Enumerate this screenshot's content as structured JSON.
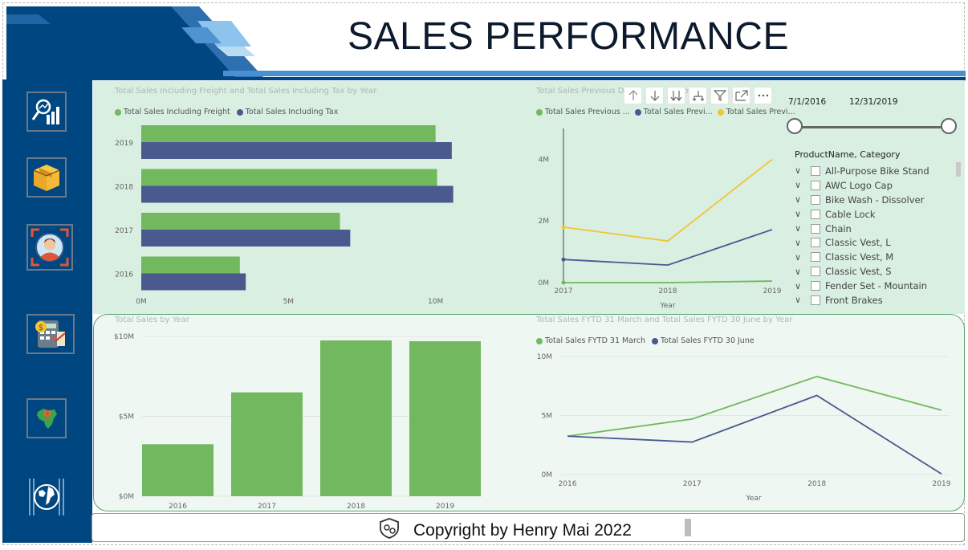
{
  "header": {
    "title": "SALES PERFORMANCE"
  },
  "nav": [
    {
      "name": "analytics-icon"
    },
    {
      "name": "product-box-icon"
    },
    {
      "name": "customer-target-icon"
    },
    {
      "name": "finance-calculator-icon"
    },
    {
      "name": "map-region-icon"
    },
    {
      "name": "globe-icon"
    }
  ],
  "colors": {
    "green": "#72b85e",
    "navy": "#4a5a8f",
    "yellow": "#f2c531",
    "sidebar": "#004680"
  },
  "visuals": {
    "top_left": {
      "title": "Total Sales Including Freight and Total Sales Including Tax by Year",
      "legend": [
        "Total Sales Including Freight",
        "Total Sales Including Tax"
      ]
    },
    "top_right": {
      "title": "Total Sales Previous D",
      "title_tail": "s b",
      "legend": [
        "Total Sales Previous ...",
        "Total Sales Previ...",
        "Total Sales Previ..."
      ],
      "xlabel": "Year"
    },
    "bottom_left": {
      "title": "Total Sales by Year"
    },
    "bottom_right": {
      "title": "Total Sales FYTD 31 March and Total Sales FYTD 30 June by Year",
      "legend": [
        "Total Sales FYTD 31 March",
        "Total Sales FYTD 30 June"
      ],
      "xlabel": "Year"
    }
  },
  "chart_data": [
    {
      "type": "bar",
      "orientation": "horizontal",
      "title": "Total Sales Including Freight and Total Sales Including Tax by Year",
      "categories": [
        "2019",
        "2018",
        "2017",
        "2016"
      ],
      "series": [
        {
          "name": "Total Sales Including Freight",
          "values": [
            10.0,
            10.05,
            6.75,
            3.35
          ]
        },
        {
          "name": "Total Sales Including Tax",
          "values": [
            10.55,
            10.6,
            7.1,
            3.55
          ]
        }
      ],
      "xticks": [
        "0M",
        "5M",
        "10M"
      ],
      "xlim": [
        0,
        12
      ],
      "unit": "M"
    },
    {
      "type": "line",
      "title": "Total Sales Previous D...s b...",
      "x": [
        "2017",
        "2018",
        "2019"
      ],
      "series": [
        {
          "name": "Total Sales Previous ...",
          "values": [
            0.0,
            0.0,
            0.05
          ]
        },
        {
          "name": "Total Sales Previ...",
          "values": [
            0.75,
            0.57,
            1.72
          ]
        },
        {
          "name": "Total Sales Previ...",
          "values": [
            1.8,
            1.35,
            4.0
          ]
        }
      ],
      "yticks": [
        "0M",
        "2M",
        "4M"
      ],
      "ylim": [
        0,
        5
      ],
      "xlabel": "Year",
      "unit": "M"
    },
    {
      "type": "bar",
      "title": "Total Sales by Year",
      "categories": [
        "2016",
        "2017",
        "2018",
        "2019"
      ],
      "values": [
        3.25,
        6.5,
        9.75,
        9.7
      ],
      "yticks": [
        "$0M",
        "$5M",
        "$10M"
      ],
      "ylim": [
        0,
        10
      ],
      "unit": "M"
    },
    {
      "type": "line",
      "title": "Total Sales FYTD 31 March and Total Sales FYTD 30 June by Year",
      "x": [
        "2016",
        "2017",
        "2018",
        "2019"
      ],
      "series": [
        {
          "name": "Total Sales FYTD 31 March",
          "values": [
            3.25,
            4.7,
            8.3,
            5.45
          ]
        },
        {
          "name": "Total Sales FYTD 30 June",
          "values": [
            3.25,
            2.75,
            6.7,
            0.05
          ]
        }
      ],
      "yticks": [
        "0M",
        "5M",
        "10M"
      ],
      "ylim": [
        0,
        10
      ],
      "xlabel": "Year",
      "unit": "M"
    }
  ],
  "slicer": {
    "date_start": "7/1/2016",
    "date_end": "12/31/2019",
    "header": "ProductName, Category",
    "items": [
      "All-Purpose Bike Stand",
      "AWC Logo Cap",
      "Bike Wash - Dissolver",
      "Cable Lock",
      "Chain",
      "Classic Vest, L",
      "Classic Vest, M",
      "Classic Vest, S",
      "Fender Set - Mountain",
      "Front Brakes"
    ]
  },
  "toolbar": [
    "arrow-up-icon",
    "arrow-down-icon",
    "double-arrow-down-icon",
    "expand-hierarchy-icon",
    "filter-icon",
    "focus-mode-icon",
    "more-options-icon"
  ],
  "footer": {
    "copyright": "Copyright by Henry Mai 2022"
  }
}
